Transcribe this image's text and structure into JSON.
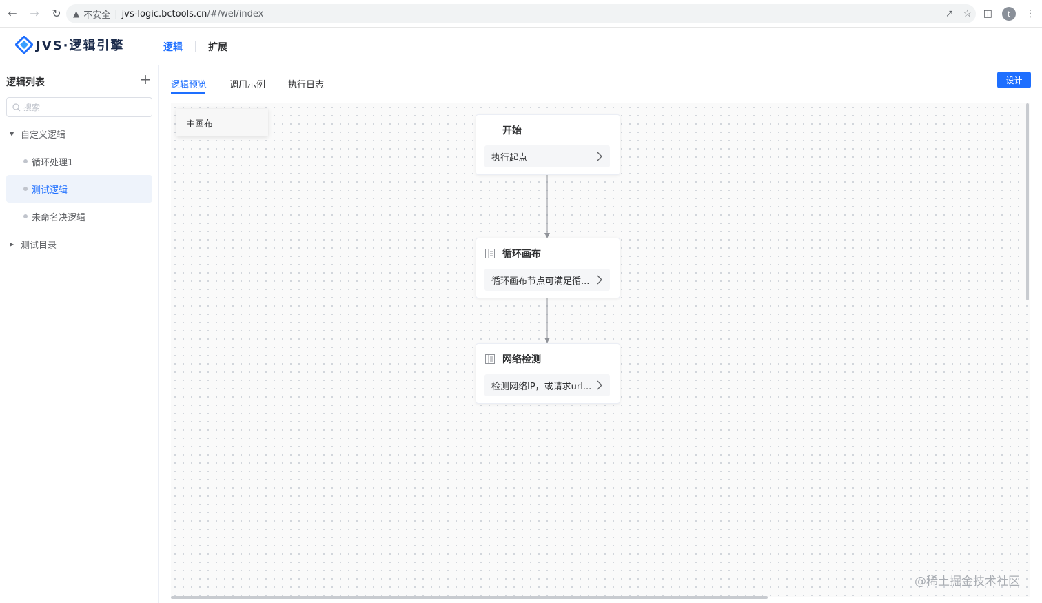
{
  "browser": {
    "security_label": "不安全",
    "url_host": "jvs-logic.bctools.cn",
    "url_path": "/#/wel/index",
    "avatar_letter": "t"
  },
  "header": {
    "logo_text": "JVS·逻辑引擎",
    "nav": [
      {
        "label": "逻辑",
        "active": true
      },
      {
        "label": "扩展",
        "active": false
      }
    ]
  },
  "sidebar": {
    "title": "逻辑列表",
    "add_label": "+",
    "search_placeholder": "搜索",
    "tree": [
      {
        "label": "自定义逻辑",
        "type": "folder",
        "expanded": true
      },
      {
        "label": "循环处理1",
        "type": "item"
      },
      {
        "label": "测试逻辑",
        "type": "item",
        "selected": true
      },
      {
        "label": "未命名决逻辑",
        "type": "item"
      },
      {
        "label": "测试目录",
        "type": "folder",
        "expanded": false
      }
    ]
  },
  "main": {
    "tabs": [
      {
        "label": "逻辑预览",
        "active": true
      },
      {
        "label": "调用示例",
        "active": false
      },
      {
        "label": "执行日志",
        "active": false
      }
    ],
    "design_button": "设计",
    "canvas_tab": "主画布",
    "nodes": [
      {
        "title": "开始",
        "desc": "执行起点"
      },
      {
        "title": "循环画布",
        "desc": "循环画布节点可满足循..."
      },
      {
        "title": "网络检测",
        "desc": "检测网络IP，或请求url..."
      }
    ],
    "watermark": "@稀土掘金技术社区"
  },
  "colors": {
    "accent": "#1e6fff",
    "selected_bg": "#eef3fb",
    "canvas_bg": "#fafafa"
  }
}
